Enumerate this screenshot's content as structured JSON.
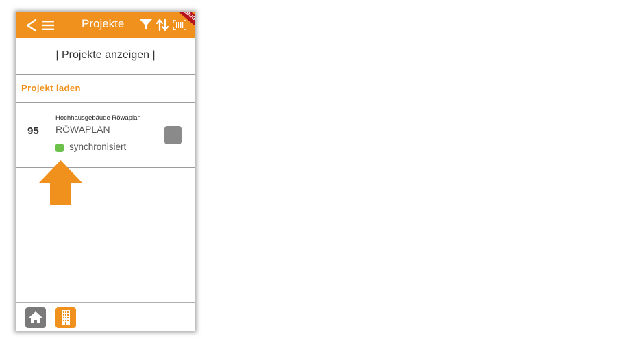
{
  "topbar": {
    "title": "Projekte",
    "debug_label": "DEBUG",
    "icons": [
      "back-icon",
      "menu-icon",
      "filter-icon",
      "sort-icon",
      "barcode-icon"
    ]
  },
  "header": {
    "text": "| Projekte anzeigen |"
  },
  "actions": {
    "load_link": "Projekt laden"
  },
  "projects": [
    {
      "number": "95",
      "name": "Hochhausgebäude Röwaplan",
      "code": "RÖWAPLAN",
      "status": "synchronisiert",
      "status_color": "#6cc14a"
    }
  ],
  "bottom_nav": {
    "items": [
      "home-icon",
      "building-icon"
    ]
  },
  "colors": {
    "accent": "#f0911d",
    "debug_ribbon": "#b5121b",
    "checkbox": "#8a8a8a"
  }
}
